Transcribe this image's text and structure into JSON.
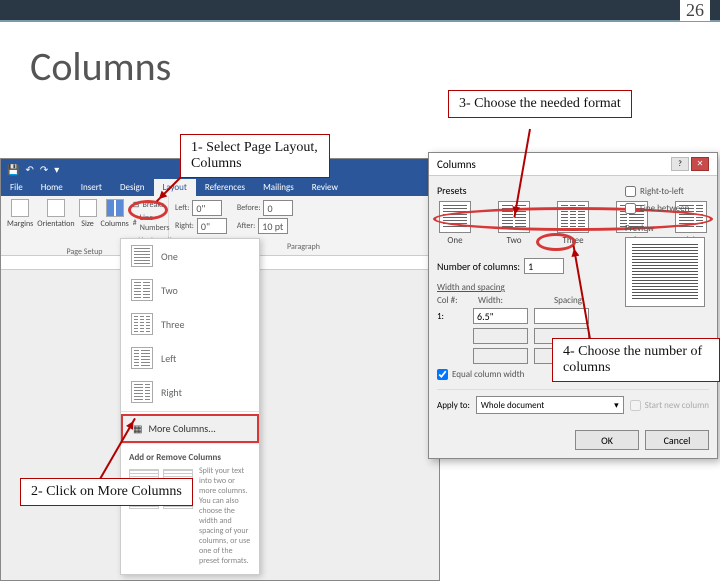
{
  "page_number": "26",
  "title": "Columns",
  "callouts": {
    "c1": "1- Select Page Layout, Columns",
    "c2": "2- Click on More Columns",
    "c3": "3- Choose the needed format",
    "c4": "4- Choose the number of columns"
  },
  "ribbon": {
    "tabs": [
      "File",
      "Home",
      "Insert",
      "Design",
      "Layout",
      "References",
      "Mailings",
      "Review"
    ],
    "active_tab": "Layout",
    "groups": {
      "page_setup": {
        "margins": "Margins",
        "orientation": "Orientation",
        "size": "Size",
        "columns": "Columns",
        "breaks": "Breaks",
        "line_numbers": "Line Numbers",
        "hyphenation": "Hyphenation",
        "label": "Page Setup"
      },
      "paragraph": {
        "indent_left": "Left:",
        "indent_right": "Right:",
        "before": "Before:",
        "after": "After:",
        "left_val": "0\"",
        "right_val": "0\"",
        "before_val": "0",
        "after_val": "10 pt",
        "label": "Paragraph"
      }
    }
  },
  "dropdown": {
    "items": [
      "One",
      "Two",
      "Three",
      "Left",
      "Right"
    ],
    "more": "More Columns...",
    "help_title": "Add or Remove Columns",
    "help_body": "Split your text into two or more columns.\nYou can also choose the width and spacing of your columns, or use one of the preset formats."
  },
  "dialog": {
    "title": "Columns",
    "presets_label": "Presets",
    "presets": [
      "One",
      "Two",
      "Three",
      "Left",
      "Right"
    ],
    "number_label": "Number of columns:",
    "number_value": "1",
    "rtl": "Right-to-left",
    "line_between": "Line between",
    "ws_label": "Width and spacing",
    "ws_headers": [
      "Col #:",
      "Width:",
      "Spacing:"
    ],
    "ws_col": "1:",
    "ws_width": "6.5\"",
    "ws_spacing": "",
    "equal": "Equal column width",
    "preview_label": "Preview",
    "apply_label": "Apply to:",
    "apply_value": "Whole document",
    "start_new": "Start new column",
    "ok": "OK",
    "cancel": "Cancel"
  }
}
